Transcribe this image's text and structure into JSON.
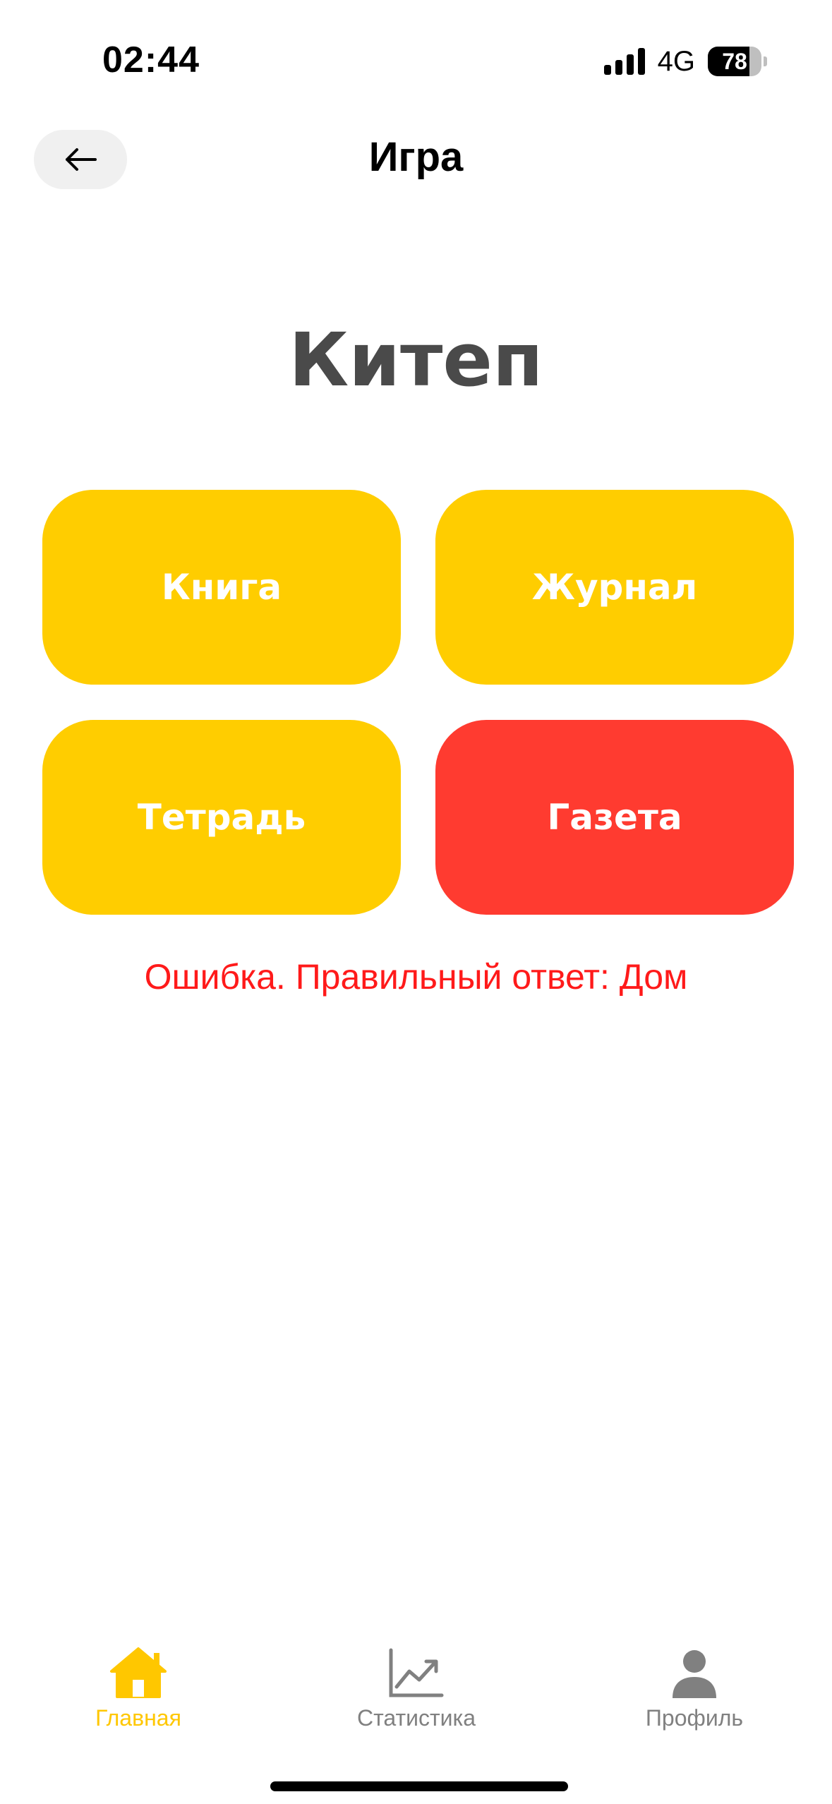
{
  "status_bar": {
    "time": "02:44",
    "network": "4G",
    "battery": "78",
    "battery_level_percent": 78
  },
  "header": {
    "title": "Игра",
    "back_icon": "arrow-left-icon"
  },
  "question": {
    "word": "Китеп"
  },
  "options": [
    {
      "label": "Книга",
      "state": "default",
      "color": "#ffcd00"
    },
    {
      "label": "Журнал",
      "state": "default",
      "color": "#ffcd00"
    },
    {
      "label": "Тетрадь",
      "state": "default",
      "color": "#ffcd00"
    },
    {
      "label": "Газета",
      "state": "wrong",
      "color": "#ff3b30"
    }
  ],
  "feedback": {
    "text": "Ошибка. Правильный ответ: Дом",
    "color": "#ff1a1a"
  },
  "tab_bar": {
    "active_color": "#ffc700",
    "inactive_color": "#808080",
    "tabs": [
      {
        "label": "Главная",
        "icon": "home-icon",
        "active": true
      },
      {
        "label": "Статистика",
        "icon": "chart-icon",
        "active": false
      },
      {
        "label": "Профиль",
        "icon": "person-icon",
        "active": false
      }
    ]
  }
}
